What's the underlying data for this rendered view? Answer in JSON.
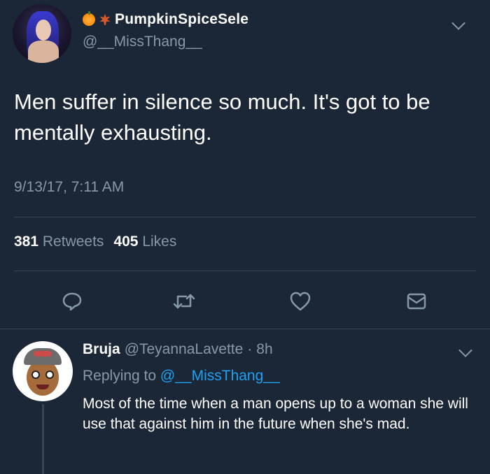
{
  "tweet": {
    "display_name": "PumpkinSpiceSele",
    "handle": "@__MissThang__",
    "text": "Men suffer in silence so much. It's got to be mentally exhausting.",
    "timestamp": "9/13/17, 7:11 AM",
    "retweets_count": "381",
    "retweets_label": "Retweets",
    "likes_count": "405",
    "likes_label": "Likes",
    "name_emojis": [
      "jack-o-lantern-icon",
      "maple-leaf-icon"
    ],
    "actions": [
      "reply-icon",
      "retweet-icon",
      "like-icon",
      "message-icon"
    ]
  },
  "reply": {
    "display_name": "Bruja",
    "handle": "@TeyannaLavette",
    "separator": "·",
    "time": "8h",
    "replying_prefix": "Replying to",
    "replying_handle": "@__MissThang__",
    "text": "Most of the time when a man opens up to a woman she will use that against him in the future when she's mad."
  },
  "colors": {
    "background": "#1b2736",
    "muted": "#8899a6",
    "link": "#1da1f2",
    "divider": "#38444d"
  }
}
